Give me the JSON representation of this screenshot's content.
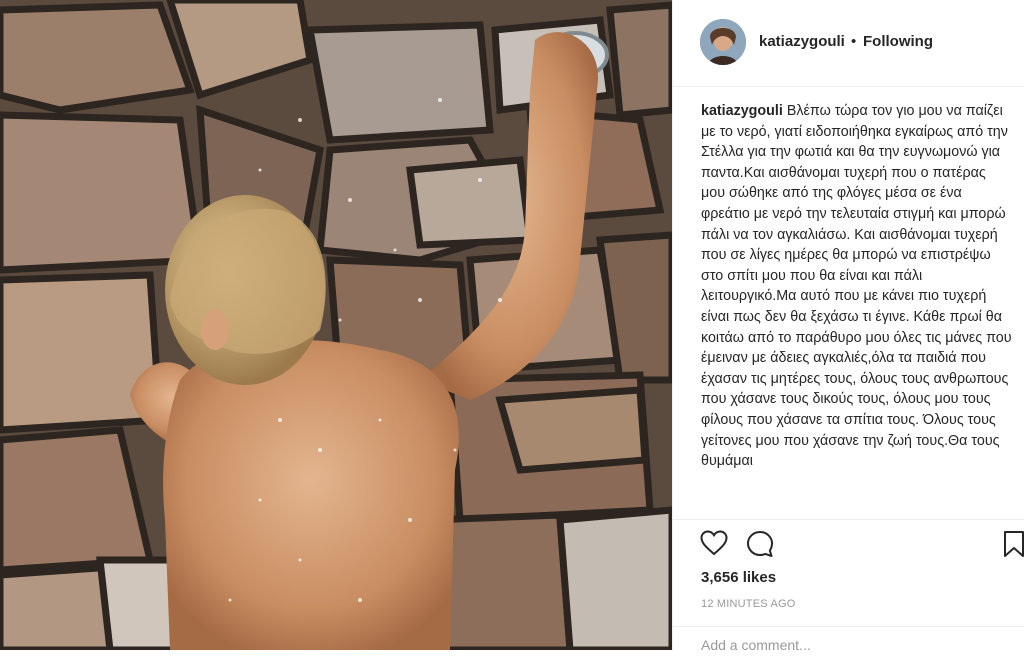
{
  "post": {
    "username": "katiazygouli",
    "separator": "•",
    "follow_status": "Following",
    "caption": "Βλέπω τώρα τον γιο μου να παίζει με το νερό, γιατί ειδοποιήθηκα εγκαίρως από την Στέλλα για την φωτιά και θα την ευγνωμονώ για παντα.Και αισθάνομαι τυχερή που ο πατέρας μου σώθηκε από της φλόγες μέσα σε ένα φρεάτιο με νερό την τελευταία στιγμή και μπορώ πάλι να τον αγκαλιάσω. Και αισθάνομαι τυχερή που σε λίγες ημέρες θα μπορώ να επιστρέψω στο σπίτι μου που θα είναι και πάλι λειτουργικό.Μα αυτό που με κάνει πιο τυχερή είναι πως δεν θα ξεχάσω τι έγινε. Κάθε πρωί θα κοιτάω από το παράθυρο μου όλες τις μάνες που έμειναν με άδειες αγκαλιές,όλα τα παιδιά που έχασαν τις μητέρες τους, όλους τους ανθρωπους που χάσανε τους δικούς τους, όλους μου τους φίλους που χάσανε τα σπίτια τους. Όλους τους γείτονες μου που χάσανε την ζωή τους.Θα τους θυμάμαι",
    "likes": "3,656 likes",
    "timestamp": "12 MINUTES AGO",
    "add_comment_placeholder": "Add a comment..."
  },
  "icons": {
    "heart": "heart-icon",
    "comment": "comment-icon",
    "bookmark": "bookmark-icon"
  }
}
